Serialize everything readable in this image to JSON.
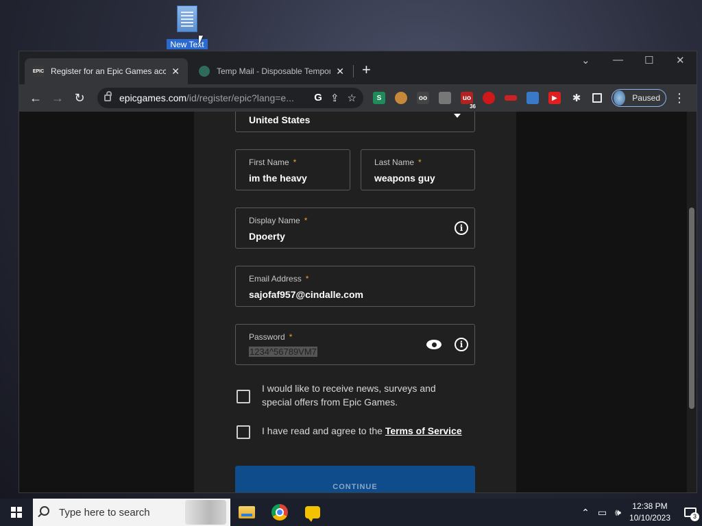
{
  "desktop": {
    "icon_label": "New Text"
  },
  "browser": {
    "tabs": [
      {
        "favicon": "EPIC",
        "title": "Register for an Epic Games account",
        "close": "✕"
      },
      {
        "favicon": "",
        "title": "Temp Mail - Disposable Temporary Email",
        "close": "✕"
      }
    ],
    "new_tab": "+",
    "window_controls": {
      "dropdown": "⌄",
      "minimize": "—",
      "maximize": "☐",
      "close": "✕"
    },
    "url_host": "epicgames.com",
    "url_path": "/id/register/epic?lang=e...",
    "extensions": [
      {
        "name": "S",
        "color": "#1f8a5a"
      },
      {
        "name": "cookie",
        "color": "#c8883a"
      },
      {
        "name": "oo",
        "color": "#444444"
      },
      {
        "name": "ext",
        "color": "#777777"
      },
      {
        "name": "uo",
        "color": "#b22222",
        "badge": "36"
      },
      {
        "name": "red",
        "color": "#d01818"
      },
      {
        "name": "ext2",
        "color": "#cc2222"
      },
      {
        "name": "img",
        "color": "#3a78c8"
      },
      {
        "name": "yt",
        "color": "#e02020"
      }
    ],
    "profile_status": "Paused"
  },
  "form": {
    "country_value": "United States",
    "first_name_label": "First Name",
    "first_name_value": "im the heavy",
    "last_name_label": "Last Name",
    "last_name_value": "weapons guy",
    "display_name_label": "Display Name",
    "display_name_value": "Dpoerty",
    "email_label": "Email Address",
    "email_value": "sajofaf957@cindalle.com",
    "password_label": "Password",
    "password_value": "1234^56789VM7",
    "required_mark": "*",
    "news_line1": "I would like to receive news, surveys and",
    "news_line2": "special offers from Epic Games.",
    "tos_prefix": "I have read and agree to the",
    "tos_link": "Terms of Service",
    "continue_label": "CONTINUE"
  },
  "taskbar": {
    "search_placeholder": "Type here to search",
    "time": "12:38 PM",
    "date": "10/10/2023",
    "notification_count": "3"
  }
}
